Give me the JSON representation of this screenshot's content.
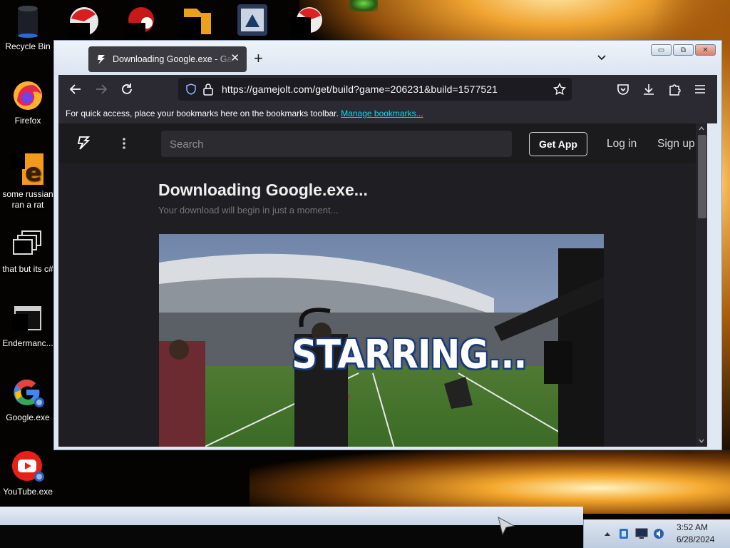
{
  "desktop": {
    "icons": [
      {
        "label": "Recycle Bin"
      },
      {
        "label": "Firefox"
      },
      {
        "label": "some russian ran a rat"
      },
      {
        "label": "that but its c#"
      },
      {
        "label": "Endermanc..."
      },
      {
        "label": "Google.exe"
      },
      {
        "label": "YouTube.exe"
      }
    ]
  },
  "browser": {
    "tab": {
      "title": "Downloading Google.exe - GameJolt",
      "close": "✕"
    },
    "new_tab": "+",
    "window_controls": {
      "minimize": "▭",
      "maximize": "⧉",
      "close": "✕"
    },
    "url": "https://gamejolt.com/get/build?game=206231&build=1577521",
    "bookmarks_bar": {
      "text": "For quick access, place your bookmarks here on the bookmarks toolbar.",
      "link": "Manage bookmarks..."
    }
  },
  "page": {
    "search_placeholder": "Search",
    "get_app": "Get App",
    "login": "Log in",
    "signup": "Sign up",
    "title": "Downloading Google.exe...",
    "subtitle": "Your download will begin in just a moment...",
    "video_caption": "STARRING..."
  },
  "taskbar": {
    "time": "3:52 AM",
    "date": "6/28/2024"
  },
  "colors": {
    "browser_dark": "#2b2a33",
    "url_bg": "#1c1b22",
    "link": "#00ddff",
    "gj_bg": "#1f1e22"
  }
}
